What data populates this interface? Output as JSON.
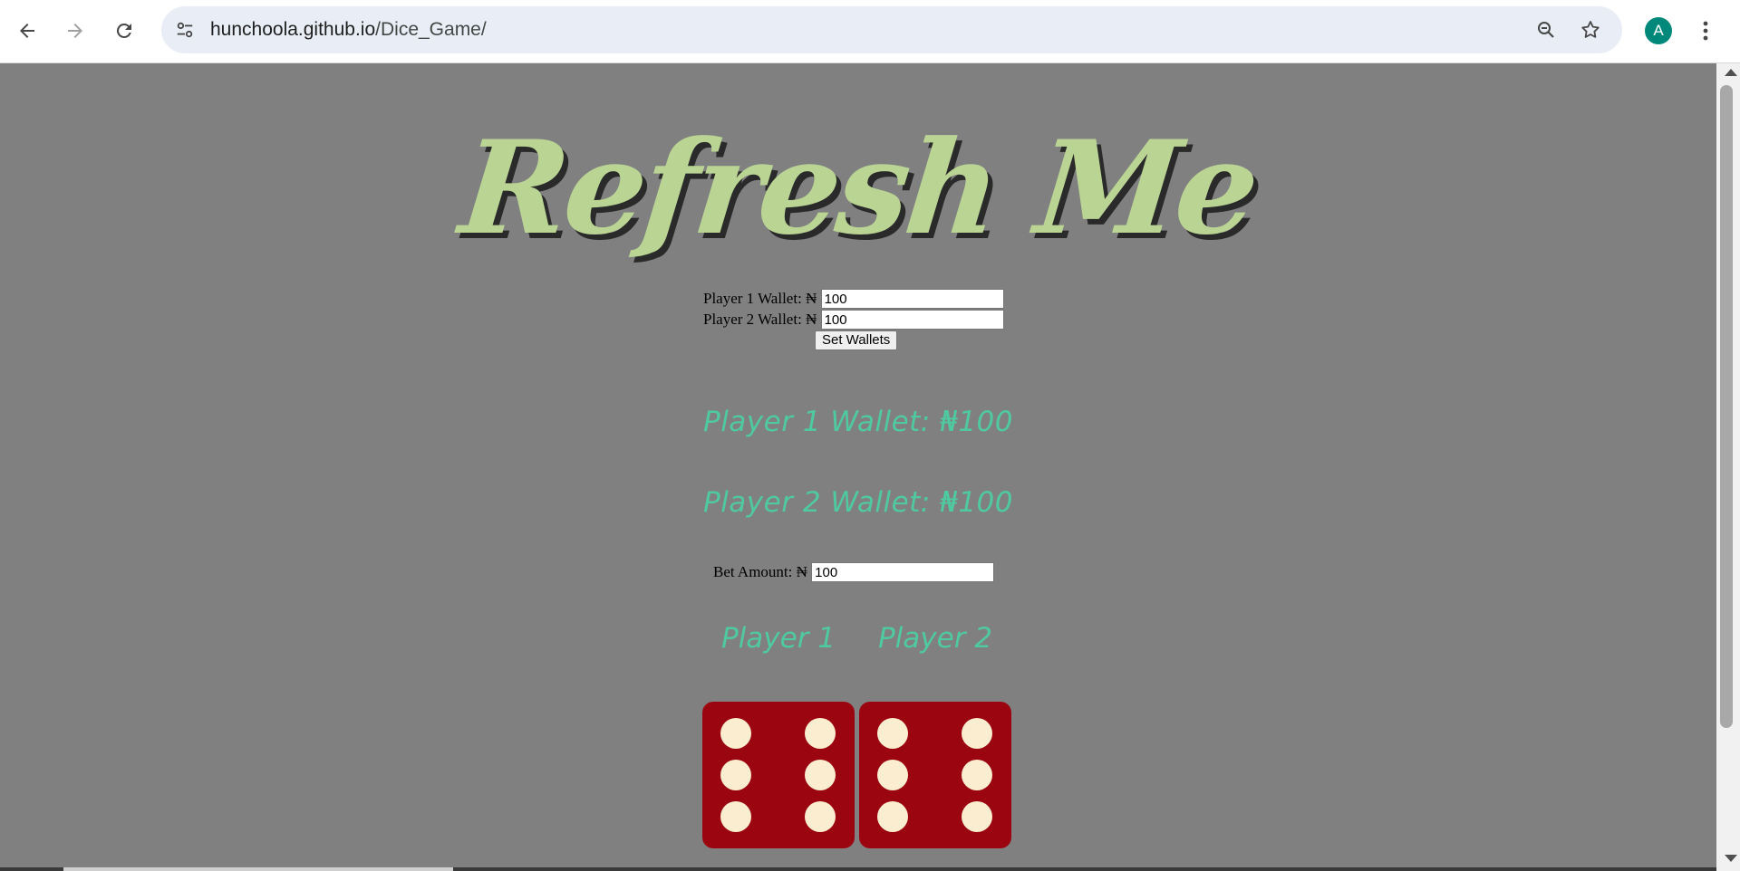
{
  "browser": {
    "url_host": "hunchoola.github.io",
    "url_path": "/Dice_Game/",
    "avatar_letter": "A",
    "icons": [
      "back-arrow-icon",
      "forward-arrow-icon",
      "reload-icon",
      "site-info-icon",
      "zoom-icon",
      "bookmark-star-icon",
      "kebab-menu-icon"
    ]
  },
  "page": {
    "title": "Refresh Me",
    "wallet_form": {
      "player1_label": "Player 1 Wallet: ₦",
      "player1_value": "100",
      "player2_label": "Player 2 Wallet: ₦",
      "player2_value": "100",
      "set_button": "Set Wallets"
    },
    "wallet_display": {
      "player1": "Player 1 Wallet: ₦100",
      "player2": "Player 2 Wallet: ₦100"
    },
    "bet": {
      "label": "Bet Amount: ₦",
      "value": "100"
    },
    "players": {
      "player1": "Player 1",
      "player2": "Player 2"
    },
    "dice": {
      "player1_value": 6,
      "player2_value": 6,
      "face_color": "#9b0510",
      "pip_color": "#fbedd0"
    }
  },
  "colors": {
    "page_background": "#808080",
    "title": "#bad494",
    "accent_text": "#4fc9a0"
  }
}
